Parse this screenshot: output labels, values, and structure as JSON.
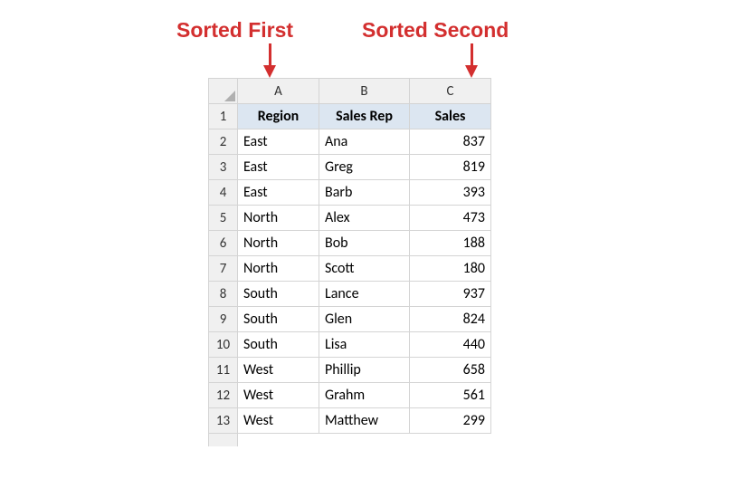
{
  "labels": {
    "first": "Sorted First",
    "second": "Sorted Second"
  },
  "columns": [
    "A",
    "B",
    "C"
  ],
  "headers": {
    "A": "Region",
    "B": "Sales Rep",
    "C": "Sales"
  },
  "rows": [
    {
      "n": 1,
      "A": "Region",
      "B": "Sales Rep",
      "C": "Sales",
      "isHeader": true
    },
    {
      "n": 2,
      "A": "East",
      "B": "Ana",
      "C": 837
    },
    {
      "n": 3,
      "A": "East",
      "B": "Greg",
      "C": 819
    },
    {
      "n": 4,
      "A": "East",
      "B": "Barb",
      "C": 393
    },
    {
      "n": 5,
      "A": "North",
      "B": "Alex",
      "C": 473
    },
    {
      "n": 6,
      "A": "North",
      "B": "Bob",
      "C": 188
    },
    {
      "n": 7,
      "A": "North",
      "B": "Scott",
      "C": 180
    },
    {
      "n": 8,
      "A": "South",
      "B": "Lance",
      "C": 937
    },
    {
      "n": 9,
      "A": "South",
      "B": "Glen",
      "C": 824
    },
    {
      "n": 10,
      "A": "South",
      "B": "Lisa",
      "C": 440
    },
    {
      "n": 11,
      "A": "West",
      "B": "Phillip",
      "C": 658
    },
    {
      "n": 12,
      "A": "West",
      "B": "Grahm",
      "C": 561
    },
    {
      "n": 13,
      "A": "West",
      "B": "Matthew",
      "C": 299
    }
  ],
  "chart_data": {
    "type": "table",
    "title": "",
    "columns": [
      "Region",
      "Sales Rep",
      "Sales"
    ],
    "data": [
      [
        "East",
        "Ana",
        837
      ],
      [
        "East",
        "Greg",
        819
      ],
      [
        "East",
        "Barb",
        393
      ],
      [
        "North",
        "Alex",
        473
      ],
      [
        "North",
        "Bob",
        188
      ],
      [
        "North",
        "Scott",
        180
      ],
      [
        "South",
        "Lance",
        937
      ],
      [
        "South",
        "Glen",
        824
      ],
      [
        "South",
        "Lisa",
        440
      ],
      [
        "West",
        "Phillip",
        658
      ],
      [
        "West",
        "Grahm",
        561
      ],
      [
        "West",
        "Matthew",
        299
      ]
    ],
    "sort": [
      {
        "column": "Region",
        "order": "asc",
        "priority": 1
      },
      {
        "column": "Sales",
        "order": "desc",
        "priority": 2
      }
    ]
  }
}
